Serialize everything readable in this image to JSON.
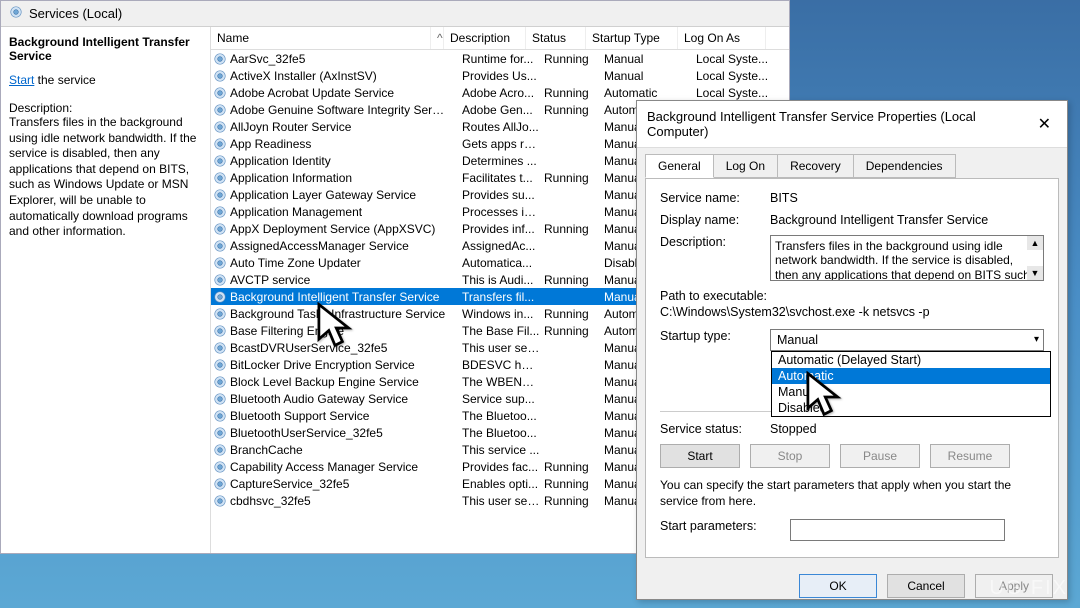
{
  "servicesWindow": {
    "title": "Services (Local)",
    "selectedService": {
      "name": "Background Intelligent Transfer Service",
      "linkPrefix": "Start",
      "linkSuffix": " the service",
      "descLabel": "Description:",
      "description": "Transfers files in the background using idle network bandwidth. If the service is disabled, then any applications that depend on BITS, such as Windows Update or MSN Explorer, will be unable to automatically download programs and other information."
    },
    "columns": {
      "name": "Name",
      "description": "Description",
      "status": "Status",
      "startup": "Startup Type",
      "logon": "Log On As"
    },
    "rows": [
      {
        "name": "AarSvc_32fe5",
        "desc": "Runtime for...",
        "status": "Running",
        "startup": "Manual",
        "logon": "Local Syste..."
      },
      {
        "name": "ActiveX Installer (AxInstSV)",
        "desc": "Provides Us...",
        "status": "",
        "startup": "Manual",
        "logon": "Local Syste..."
      },
      {
        "name": "Adobe Acrobat Update Service",
        "desc": "Adobe Acro...",
        "status": "Running",
        "startup": "Automatic",
        "logon": "Local Syste..."
      },
      {
        "name": "Adobe Genuine Software Integrity Service",
        "desc": "Adobe Gen...",
        "status": "Running",
        "startup": "Automatic",
        "logon": ""
      },
      {
        "name": "AllJoyn Router Service",
        "desc": "Routes AllJo...",
        "status": "",
        "startup": "Manual (Trig...",
        "logon": ""
      },
      {
        "name": "App Readiness",
        "desc": "Gets apps re...",
        "status": "",
        "startup": "Manual",
        "logon": ""
      },
      {
        "name": "Application Identity",
        "desc": "Determines ...",
        "status": "",
        "startup": "Manual (Trig...",
        "logon": ""
      },
      {
        "name": "Application Information",
        "desc": "Facilitates t...",
        "status": "Running",
        "startup": "Manual (Trig...",
        "logon": ""
      },
      {
        "name": "Application Layer Gateway Service",
        "desc": "Provides su...",
        "status": "",
        "startup": "Manual",
        "logon": ""
      },
      {
        "name": "Application Management",
        "desc": "Processes in...",
        "status": "",
        "startup": "Manual",
        "logon": ""
      },
      {
        "name": "AppX Deployment Service (AppXSVC)",
        "desc": "Provides inf...",
        "status": "Running",
        "startup": "Manual (Trig...",
        "logon": ""
      },
      {
        "name": "AssignedAccessManager Service",
        "desc": "AssignedAc...",
        "status": "",
        "startup": "Manual (Trig...",
        "logon": ""
      },
      {
        "name": "Auto Time Zone Updater",
        "desc": "Automatica...",
        "status": "",
        "startup": "Disabled",
        "logon": ""
      },
      {
        "name": "AVCTP service",
        "desc": "This is Audi...",
        "status": "Running",
        "startup": "Manual (Trig...",
        "logon": ""
      },
      {
        "name": "Background Intelligent Transfer Service",
        "desc": "Transfers fil...",
        "status": "",
        "startup": "Manual",
        "logon": "",
        "selected": true
      },
      {
        "name": "Background Tasks Infrastructure Service",
        "desc": "Windows in...",
        "status": "Running",
        "startup": "Automatic",
        "logon": ""
      },
      {
        "name": "Base Filtering Engine",
        "desc": "The Base Fil...",
        "status": "Running",
        "startup": "Automatic",
        "logon": ""
      },
      {
        "name": "BcastDVRUserService_32fe5",
        "desc": "This user ser...",
        "status": "",
        "startup": "Manual",
        "logon": ""
      },
      {
        "name": "BitLocker Drive Encryption Service",
        "desc": "BDESVC hos...",
        "status": "",
        "startup": "Manual (Trig...",
        "logon": ""
      },
      {
        "name": "Block Level Backup Engine Service",
        "desc": "The WBENG...",
        "status": "",
        "startup": "Manual",
        "logon": ""
      },
      {
        "name": "Bluetooth Audio Gateway Service",
        "desc": "Service sup...",
        "status": "",
        "startup": "Manual (Trig...",
        "logon": ""
      },
      {
        "name": "Bluetooth Support Service",
        "desc": "The Bluetoo...",
        "status": "",
        "startup": "Manual (Trig...",
        "logon": ""
      },
      {
        "name": "BluetoothUserService_32fe5",
        "desc": "The Bluetoo...",
        "status": "",
        "startup": "Manual (Trig...",
        "logon": ""
      },
      {
        "name": "BranchCache",
        "desc": "This service ...",
        "status": "",
        "startup": "Manual",
        "logon": ""
      },
      {
        "name": "Capability Access Manager Service",
        "desc": "Provides fac...",
        "status": "Running",
        "startup": "Manual",
        "logon": ""
      },
      {
        "name": "CaptureService_32fe5",
        "desc": "Enables opti...",
        "status": "Running",
        "startup": "Manual",
        "logon": ""
      },
      {
        "name": "cbdhsvc_32fe5",
        "desc": "This user ser...",
        "status": "Running",
        "startup": "Manual",
        "logon": ""
      }
    ]
  },
  "dialog": {
    "title": "Background Intelligent Transfer Service Properties (Local Computer)",
    "tabs": {
      "general": "General",
      "logon": "Log On",
      "recovery": "Recovery",
      "deps": "Dependencies"
    },
    "labels": {
      "serviceName": "Service name:",
      "displayName": "Display name:",
      "description": "Description:",
      "pathLabel": "Path to executable:",
      "startupType": "Startup type:",
      "serviceStatus": "Service status:",
      "paramHelp": "You can specify the start parameters that apply when you start the service from here.",
      "startParams": "Start parameters:"
    },
    "values": {
      "serviceName": "BITS",
      "displayName": "Background Intelligent Transfer Service",
      "description": "Transfers files in the background using idle network bandwidth. If the service is disabled, then any applications that depend on BITS such as Windows",
      "path": "C:\\Windows\\System32\\svchost.exe -k netsvcs -p",
      "startupSelected": "Manual",
      "serviceStatus": "Stopped"
    },
    "dropdown": [
      "Automatic (Delayed Start)",
      "Automatic",
      "Manual",
      "Disabled"
    ],
    "buttons": {
      "start": "Start",
      "stop": "Stop",
      "pause": "Pause",
      "resume": "Resume",
      "ok": "OK",
      "cancel": "Cancel",
      "apply": "Apply"
    }
  },
  "watermark": "UG   FIX"
}
